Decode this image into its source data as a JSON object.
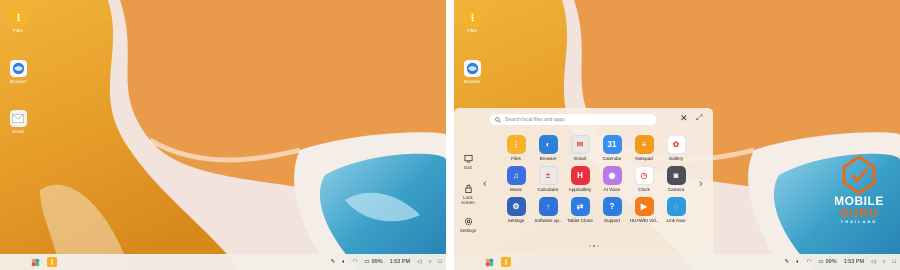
{
  "colors": {
    "sand": "#e9a42e",
    "sea": "#3fa2c8",
    "taskbar": "#f2eee8",
    "accent": "#e56a1e"
  },
  "desktop": {
    "icons": [
      {
        "label": "Files",
        "icon": "files-icon"
      },
      {
        "label": "Browser",
        "icon": "browser-icon"
      },
      {
        "label": "Email",
        "icon": "email-icon"
      }
    ]
  },
  "taskbar": {
    "battery": "99%",
    "time": "1:53 PM"
  },
  "launcher": {
    "search_placeholder": "Search local files and apps",
    "side": [
      {
        "label": "Exit",
        "icon": "exit-icon"
      },
      {
        "label": "Lock screen",
        "icon": "lock-icon"
      },
      {
        "label": "Settings",
        "icon": "settings-icon"
      }
    ],
    "apps": [
      {
        "label": "Files",
        "icon": "files-icon",
        "color": "#f6b32a",
        "glyph": "⋮"
      },
      {
        "label": "Browser",
        "icon": "browser-icon",
        "color": "#2d7fd8",
        "glyph": "◐"
      },
      {
        "label": "Email",
        "icon": "email-icon",
        "color": "#e8e8e8",
        "glyph": "✉"
      },
      {
        "label": "Calendar",
        "icon": "calendar-icon",
        "color": "#3a8ef0",
        "glyph": "31"
      },
      {
        "label": "Notepad",
        "icon": "notepad-icon",
        "color": "#f29a1c",
        "glyph": "≡"
      },
      {
        "label": "Gallery",
        "icon": "gallery-icon",
        "color": "#ffffff",
        "glyph": "✿"
      },
      {
        "label": "Music",
        "icon": "music-icon",
        "color": "#3c6fe0",
        "glyph": "♫"
      },
      {
        "label": "Calculator",
        "icon": "calculator-icon",
        "color": "#e9e9e9",
        "glyph": "±"
      },
      {
        "label": "AppGallery",
        "icon": "appgallery-icon",
        "color": "#e8313d",
        "glyph": "H"
      },
      {
        "label": "AI Voice",
        "icon": "ai-voice-icon",
        "color": "#b77be8",
        "glyph": "◉"
      },
      {
        "label": "Clock",
        "icon": "clock-icon",
        "color": "#ffffff",
        "glyph": "◷"
      },
      {
        "label": "Camera",
        "icon": "camera-icon",
        "color": "#4a4f58",
        "glyph": "◙"
      },
      {
        "label": "Settings",
        "icon": "settings-icon",
        "color": "#2f63b8",
        "glyph": "⚙"
      },
      {
        "label": "Software up..",
        "icon": "software-update-icon",
        "color": "#2f73d9",
        "glyph": "↑"
      },
      {
        "label": "Tablet Clone",
        "icon": "tablet-clone-icon",
        "color": "#2f7ce0",
        "glyph": "⇄"
      },
      {
        "label": "Support",
        "icon": "support-icon",
        "color": "#2f7ce0",
        "glyph": "?"
      },
      {
        "label": "HUAWEI Vid..",
        "icon": "huawei-video-icon",
        "color": "#f57a1a",
        "glyph": "▶"
      },
      {
        "label": "Link Now",
        "icon": "link-now-icon",
        "color": "#2e9bdd",
        "glyph": "◌"
      }
    ]
  },
  "watermark": {
    "line1": "MOBILE",
    "line2": "GURU",
    "line3": "THAILAND"
  }
}
